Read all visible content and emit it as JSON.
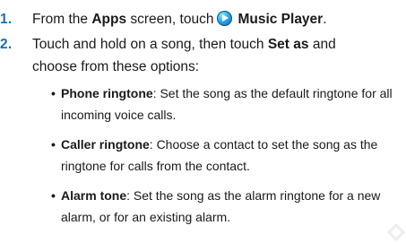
{
  "steps": [
    {
      "number": "1.",
      "lines": [
        {
          "prefix": "From the ",
          "bold1": "Apps",
          "middle": " screen, touch",
          "bold2": "Music Player",
          "suffix": "."
        }
      ],
      "icon": "music-player-icon"
    },
    {
      "number": "2.",
      "line1": {
        "prefix": "Touch and hold on a song, then touch ",
        "bold": "Set as",
        "suffix": " and"
      },
      "line2": "choose from these options:"
    }
  ],
  "options": [
    {
      "bullet": "•",
      "title": "Phone ringtone",
      "line1_rest": ": Set the song as the default ringtone for all",
      "line2": "incoming voice calls."
    },
    {
      "bullet": "•",
      "title": "Caller ringtone",
      "line1_rest": ": Choose a contact to set the song as the",
      "line2": "ringtone for calls from the contact."
    },
    {
      "bullet": "•",
      "title": "Alarm tone",
      "line1_rest": ": Set the song as the alarm ringtone for a new",
      "line2": "alarm, or for an existing alarm."
    }
  ],
  "colors": {
    "step_number": "#1a6fb5",
    "text": "#1a1a1a",
    "icon_primary": "#2aa7e0"
  }
}
